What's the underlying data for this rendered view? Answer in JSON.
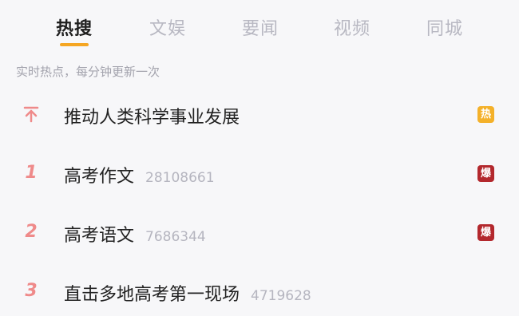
{
  "tabs": [
    {
      "label": "热搜"
    },
    {
      "label": "文娱"
    },
    {
      "label": "要闻"
    },
    {
      "label": "视频"
    },
    {
      "label": "同城"
    }
  ],
  "subtitle": "实时热点，每分钟更新一次",
  "items": [
    {
      "rank_icon": "pin-top-icon",
      "title": "推动人类科学事业发展",
      "count": "",
      "badge": "热",
      "badge_color": "#f4b12a"
    },
    {
      "rank": "1",
      "title": "高考作文",
      "count": "28108661",
      "badge": "爆",
      "badge_color": "#b3282d"
    },
    {
      "rank": "2",
      "title": "高考语文",
      "count": "7686344",
      "badge": "爆",
      "badge_color": "#b3282d"
    },
    {
      "rank": "3",
      "title": "直击多地高考第一现场",
      "count": "4719628",
      "badge": "",
      "badge_color": ""
    }
  ],
  "colors": {
    "accent": "#f5a623",
    "rank": "#ef8a8a"
  }
}
